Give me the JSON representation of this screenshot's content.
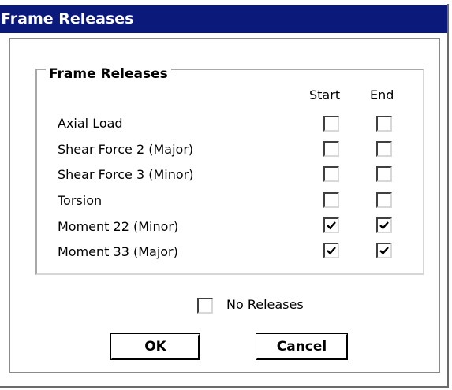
{
  "window": {
    "title": "Frame Releases"
  },
  "group": {
    "legend": "Frame Releases"
  },
  "columns": {
    "start": "Start",
    "end": "End"
  },
  "rows": [
    {
      "label": "Axial Load",
      "start": false,
      "end": false
    },
    {
      "label": "Shear Force 2 (Major)",
      "start": false,
      "end": false
    },
    {
      "label": "Shear Force 3 (Minor)",
      "start": false,
      "end": false
    },
    {
      "label": "Torsion",
      "start": false,
      "end": false
    },
    {
      "label": "Moment 22 (Minor)",
      "start": true,
      "end": true
    },
    {
      "label": "Moment 33 (Major)",
      "start": true,
      "end": true
    }
  ],
  "no_releases": {
    "label": "No Releases",
    "checked": false
  },
  "buttons": {
    "ok": "OK",
    "cancel": "Cancel"
  },
  "colors": {
    "titlebar": "#0b1a7a",
    "titlebar_text": "#ffffff"
  }
}
